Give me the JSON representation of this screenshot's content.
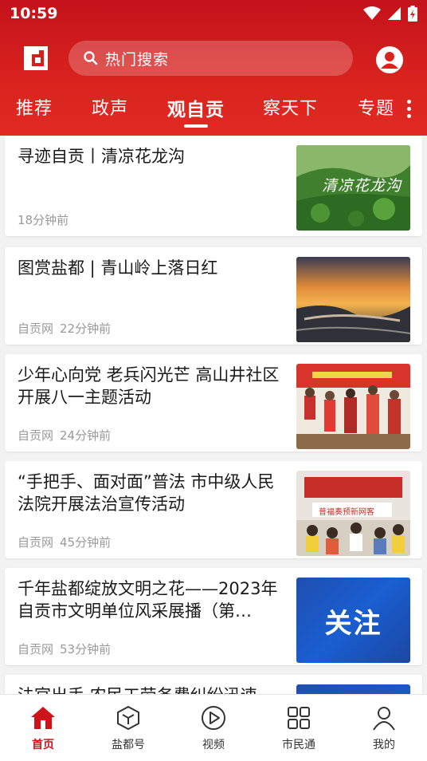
{
  "status_bar": {
    "time": "10:59"
  },
  "header": {
    "search_placeholder": "热门搜索",
    "tabs": [
      {
        "label": "推荐"
      },
      {
        "label": "政声"
      },
      {
        "label": "观自贡",
        "active": true
      },
      {
        "label": "察天下"
      },
      {
        "label": "专题"
      }
    ]
  },
  "articles": [
    {
      "title": "寻迹自贡丨清凉花龙沟",
      "source": "",
      "time": "18分钟前",
      "thumb_text": "清凉花龙沟"
    },
    {
      "title": "图赏盐都 | 青山岭上落日红",
      "source": "自贡网",
      "time": "22分钟前"
    },
    {
      "title": "少年心向党 老兵闪光芒  高山井社区开展八一主题活动",
      "source": "自贡网",
      "time": "24分钟前"
    },
    {
      "title": "“手把手、面对面”普法 市中级人民法院开展法治宣传活动",
      "source": "自贡网",
      "time": "45分钟前",
      "thumb_text": "普福奏预新网客"
    },
    {
      "title": "千年盐都绽放文明之花——2023年自贡市文明单位风采展播（第…",
      "source": "自贡网",
      "time": "53分钟前",
      "thumb_text": "关注"
    },
    {
      "title": "法官出手 农民工劳务费纠纷迅速",
      "source": "",
      "time": ""
    }
  ],
  "bottom_nav": [
    {
      "label": "首页",
      "icon": "home-icon",
      "active": true
    },
    {
      "label": "盐都号",
      "icon": "cube-icon"
    },
    {
      "label": "视频",
      "icon": "play-icon"
    },
    {
      "label": "市民通",
      "icon": "grid-icon"
    },
    {
      "label": "我的",
      "icon": "person-icon"
    }
  ],
  "colors": {
    "brand_red": "#d9231e",
    "active_nav": "#d0131b"
  }
}
